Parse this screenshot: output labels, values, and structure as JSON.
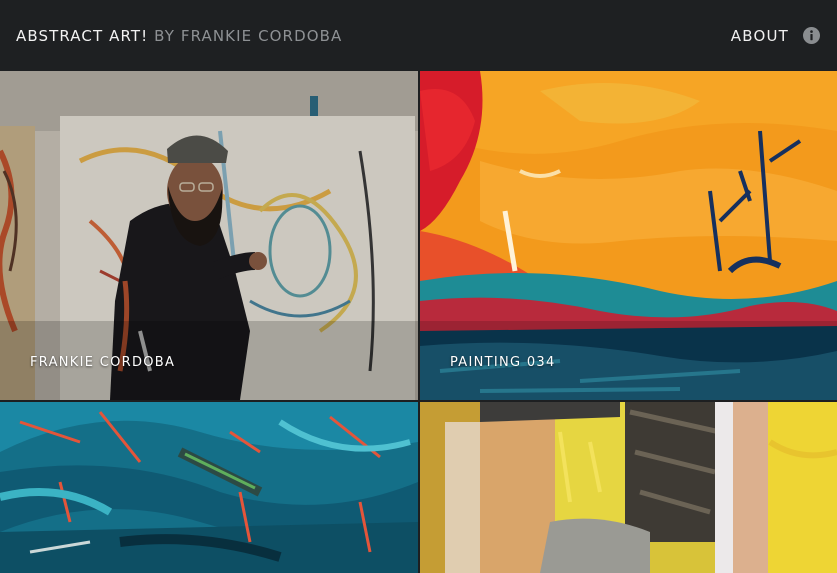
{
  "header": {
    "title_main": "ABSTRACT ART!",
    "title_by": "BY FRANKIE CORDOBA",
    "about_label": "ABOUT",
    "info_icon": "info-circle-icon"
  },
  "gallery": {
    "tiles": [
      {
        "caption": "FRANKIE CORDOBA"
      },
      {
        "caption": "PAINTING 034"
      },
      {
        "caption": ""
      },
      {
        "caption": ""
      }
    ]
  },
  "colors": {
    "header_bg": "#1e2022",
    "title_main": "#f2f2f2",
    "title_by": "#8e9194",
    "caption_text": "#ffffff"
  }
}
